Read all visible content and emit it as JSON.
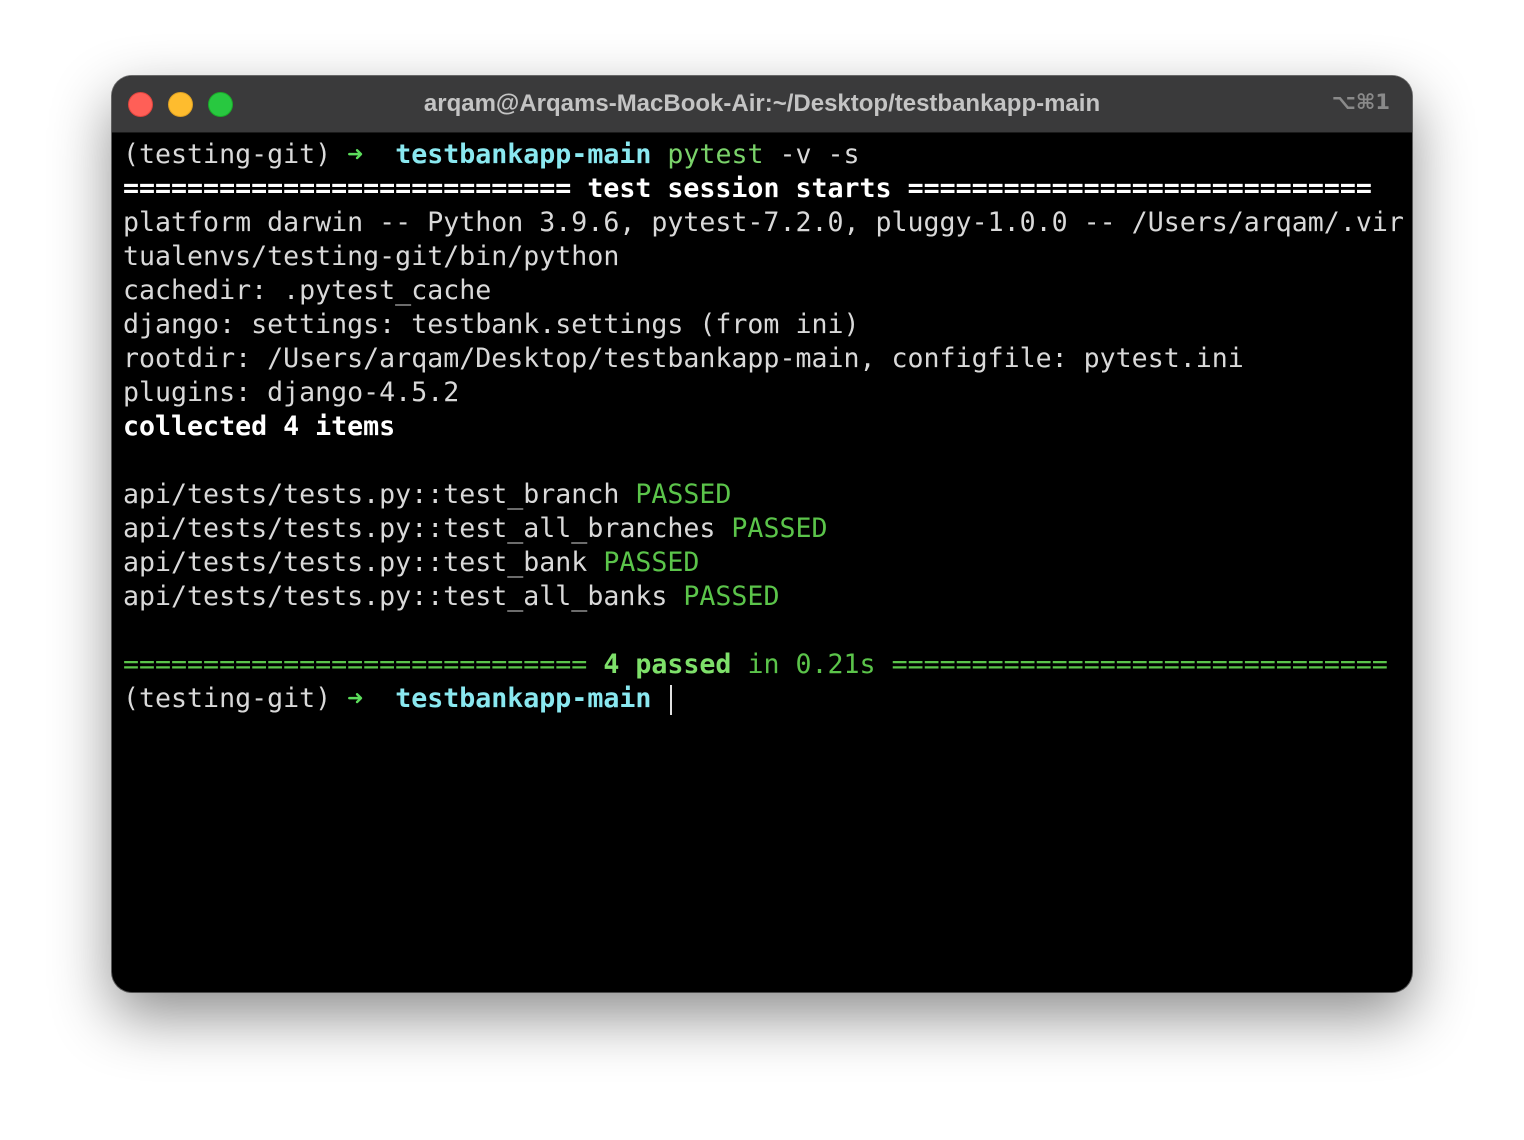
{
  "window": {
    "title": "arqam@Arqams-MacBook-Air:~/Desktop/testbankapp-main",
    "shortcut": "⌥⌘1"
  },
  "colors": {
    "green": "#5bc44a",
    "cyan": "#8ae8f0",
    "text": "#d9d9d9"
  },
  "terminal": {
    "prompt_env": "(testing-git)",
    "prompt_arrow": "➜",
    "prompt_dir": "testbankapp-main",
    "command_name": "pytest",
    "command_args": "-v -s",
    "session_sep_left": "============================",
    "session_label": "test session starts",
    "session_sep_right": "=============================",
    "platform_line_1": "platform darwin -- Python 3.9.6, pytest-7.2.0, pluggy-1.0.0 -- /Users/arqam/.vir",
    "platform_line_2": "tualenvs/testing-git/bin/python",
    "cachedir_line": "cachedir: .pytest_cache",
    "django_line": "django: settings: testbank.settings (from ini)",
    "rootdir_line": "rootdir: /Users/arqam/Desktop/testbankapp-main, configfile: pytest.ini",
    "plugins_line": "plugins: django-4.5.2",
    "collected_line": "collected 4 items",
    "tests": [
      {
        "name": "api/tests/tests.py::test_branch",
        "status": "PASSED"
      },
      {
        "name": "api/tests/tests.py::test_all_branches",
        "status": "PASSED"
      },
      {
        "name": "api/tests/tests.py::test_bank",
        "status": "PASSED"
      },
      {
        "name": "api/tests/tests.py::test_all_banks",
        "status": "PASSED"
      }
    ],
    "summary_sep_left": "=============================",
    "summary_passed": "4 passed",
    "summary_time": "in 0.21s",
    "summary_sep_right": "==============================="
  }
}
